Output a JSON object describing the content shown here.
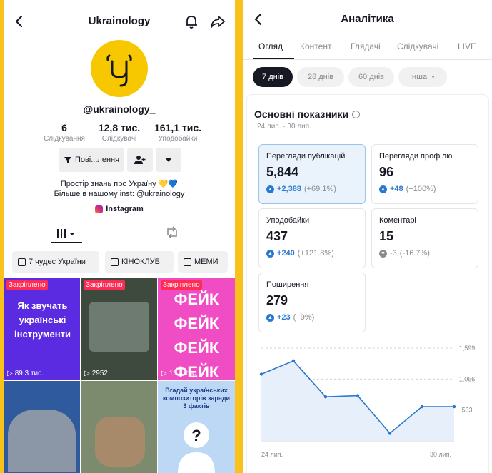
{
  "profile": {
    "title": "Ukrainology",
    "handle": "@ukrainology_",
    "stats": [
      {
        "num": "6",
        "label": "Слідкування"
      },
      {
        "num": "12,8 тис.",
        "label": "Слідкувачі"
      },
      {
        "num": "161,1 тис.",
        "label": "Уподобайки"
      }
    ],
    "follow_label": "Пові...лення",
    "bio_line1": "Простір знань про Україну 💛💙",
    "bio_line2": "Більше в нашому inst: @ukrainology",
    "instagram": "Instagram",
    "playlists": [
      "7 чудес України",
      "КІНОКЛУБ",
      "МЕМИ"
    ],
    "videos": [
      {
        "pinned": "Закріплено",
        "text": "Як звучать українські інструменти",
        "views": "89,3 тис."
      },
      {
        "pinned": "Закріплено",
        "text": "",
        "views": "2952"
      },
      {
        "pinned": "Закріплено",
        "text": "ФЕЙК ФЕЙК ФЕЙК ФЕЙК",
        "views": "13,4 тис."
      },
      {
        "pinned": "",
        "text": "",
        "views": ""
      },
      {
        "pinned": "",
        "text": "",
        "views": ""
      },
      {
        "pinned": "",
        "text": "Вгадай українських композиторів заради 3 фактів",
        "views": ""
      }
    ]
  },
  "analytics": {
    "title": "Аналітика",
    "tabs": [
      "Огляд",
      "Контент",
      "Глядачі",
      "Слідкувачі",
      "LIVE"
    ],
    "ranges": [
      "7 днів",
      "28 днів",
      "60 днів",
      "Інша"
    ],
    "section_title": "Основні показники",
    "date_range": "24 лип. - 30 лип.",
    "metrics": [
      {
        "label": "Перегляди публікацій",
        "value": "5,844",
        "delta": "+2,388",
        "pct": "(+69.1%)"
      },
      {
        "label": "Перегляди профілю",
        "value": "96",
        "delta": "+48",
        "pct": "(+100%)"
      },
      {
        "label": "Уподобайки",
        "value": "437",
        "delta": "+240",
        "pct": "(+121.8%)"
      },
      {
        "label": "Коментарі",
        "value": "15",
        "delta": "-3",
        "pct": "(-16.7%)"
      },
      {
        "label": "Поширення",
        "value": "279",
        "delta": "+23",
        "pct": "(+9%)"
      }
    ]
  },
  "chart_data": {
    "type": "line",
    "x": [
      "24 лип.",
      "25 лип.",
      "26 лип.",
      "27 лип.",
      "28 лип.",
      "29 лип.",
      "30 лип."
    ],
    "values": [
      1150,
      1380,
      760,
      780,
      130,
      590,
      590
    ],
    "x_ticks": [
      "24 лип.",
      "30 лип."
    ],
    "y_ticks": [
      "1,599",
      "1,066",
      "533"
    ],
    "ylim": [
      0,
      1599
    ],
    "color": "#2a79d0"
  }
}
